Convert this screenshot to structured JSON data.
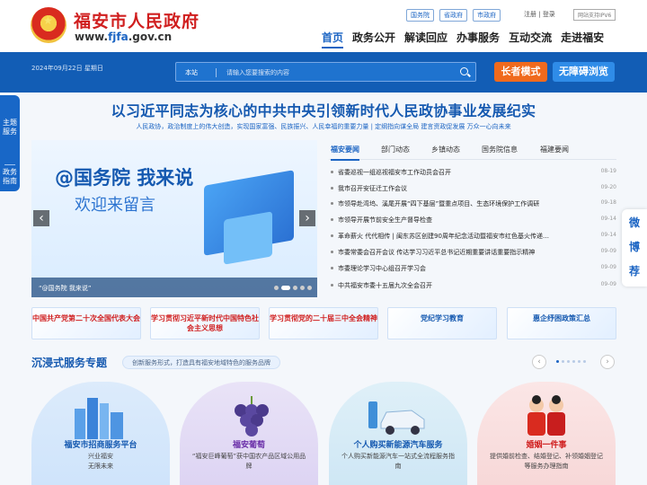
{
  "header": {
    "site_title": "福安市人民政府",
    "url_prefix": "www.",
    "url_main": "fjfa",
    "url_suffix": ".gov.cn",
    "top_links": [
      "国务院",
      "省政府",
      "市政府"
    ],
    "register": "注册",
    "login": "登录",
    "ipv6": "网站支持IPV6",
    "nav": [
      "首页",
      "政务公开",
      "解读回应",
      "办事服务",
      "互动交流",
      "走进福安"
    ]
  },
  "bar": {
    "date": "2024年09月22日 星期日",
    "search_scope": "本站",
    "search_placeholder": "请输入您要搜索的内容",
    "elder_mode": "长者模式",
    "accessible": "无障碍浏览"
  },
  "side_left": [
    "主题服务",
    "政务指南"
  ],
  "side_right": [
    "微",
    "博",
    "荐"
  ],
  "headline": "以习近平同志为核心的中共中央引领新时代人民政协事业发展纪实",
  "subheadline": "人民政协，政治制度上的伟大创造，实现国家富强、民族振兴、人民幸福的重要力量 | 定纲指向谋全局 建言资政促发展 万众一心向未来",
  "slider": {
    "title1": "@国务院 我来说",
    "title2": "欢迎来留言",
    "caption": "“@国务院 我来说”",
    "prev": "‹",
    "next": "›"
  },
  "news": {
    "tabs": [
      "福安要闻",
      "部门动态",
      "乡镇动态",
      "国务院信息",
      "福建要闻"
    ],
    "items": [
      {
        "title": "省委巡视一组巡视福安市工作动员会召开",
        "date": "08-19"
      },
      {
        "title": "我市召开安征迁工作会议",
        "date": "09-20"
      },
      {
        "title": "市领导赴湾坞、溪尾开展“四下基层”暨重点项目、生态环境保护工作调研",
        "date": "09-18"
      },
      {
        "title": "市领导开展节前安全生产督导检查",
        "date": "09-14"
      },
      {
        "title": "革命薪火 代代相传 | 闽东苏区创建90周年纪念活动暨福安市红色基火传递…",
        "date": "09-14"
      },
      {
        "title": "市委常委会召开会议 传达学习习近平总书记近期重要讲话重要指示精神",
        "date": "09-09"
      },
      {
        "title": "市委理论学习中心组召开学习会",
        "date": "09-09"
      },
      {
        "title": "中共福安市委十五届九次全会召开",
        "date": "09-09"
      }
    ]
  },
  "cards": [
    {
      "text": "中国共产党第二十次全国代表大会",
      "color": "#d01f1f"
    },
    {
      "text": "学习贯彻习近平新时代中国特色社会主义思想",
      "color": "#d01f1f"
    },
    {
      "text": "学习贯彻党的二十届三中全会精神",
      "color": "#d01f1f"
    },
    {
      "text": "党纪学习教育",
      "color": "#1559b0"
    },
    {
      "text": "惠企纾困政策汇总",
      "color": "#1559b0"
    }
  ],
  "services_section": {
    "title": "沉浸式服务专题",
    "subtitle": "创新服务形式，打造具有福安地域特色的服务品牌",
    "prev": "‹",
    "next": "›",
    "items": [
      {
        "name": "福安市招商服务平台",
        "desc": "兴业福安\n无限未来",
        "name_color": "#1559b0",
        "bg": "#dcebfb"
      },
      {
        "name": "福安葡萄",
        "desc": "“福安巨峰葡萄”获中国农产品区域公用品牌",
        "name_color": "#6a2fa8",
        "bg": "#e9e3f7"
      },
      {
        "name": "个人购买新能源汽车服务",
        "desc": "个人购买新能源汽车一站式全流程服务指南",
        "name_color": "#1559b0",
        "bg": "#dff0f8"
      },
      {
        "name": "婚姻一件事",
        "desc": "提供婚前检查、结婚登记、补领婚姻登记等服务办理指南",
        "name_color": "#d01f1f",
        "bg": "#fbe6e6"
      }
    ]
  }
}
